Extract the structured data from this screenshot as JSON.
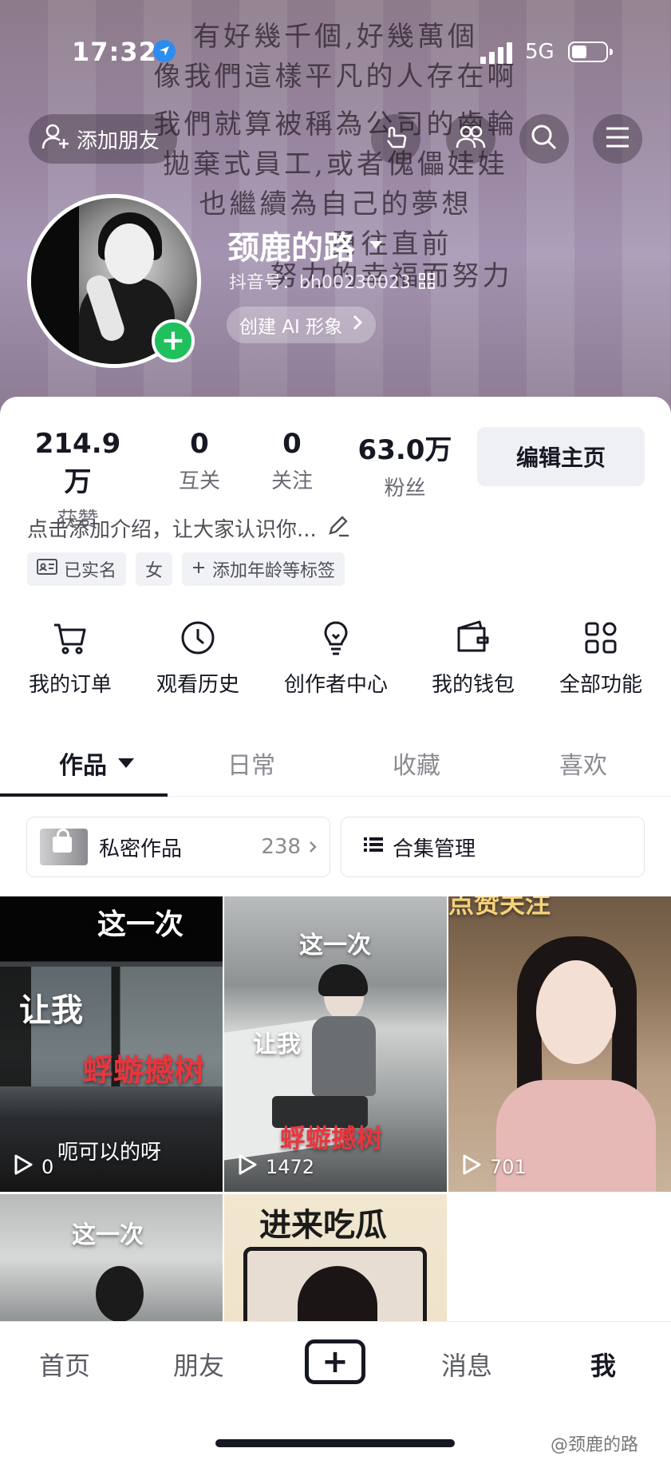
{
  "status_bar": {
    "time": "17:32",
    "network": "5G"
  },
  "cover_lyrics": [
    "有好幾千個,好幾萬個",
    "像我們這樣平凡的人存在啊",
    "我們就算被稱為公司的齒輪",
    "拋棄式員工,或者傀儡娃娃",
    "也繼續為自己的夢想",
    "勇往直前",
    "努力的幸福而努力"
  ],
  "header": {
    "add_friend_label": "添加朋友",
    "icons": [
      "visitor-icon",
      "friends-icon",
      "search-icon",
      "menu-icon"
    ]
  },
  "profile": {
    "nickname": "颈鹿的路",
    "douyin_id": "抖音号：bh00230023",
    "ai_button_label": "创建 AI 形象"
  },
  "stats": [
    {
      "value": "214.9万",
      "label": "获赞"
    },
    {
      "value": "0",
      "label": "互关"
    },
    {
      "value": "0",
      "label": "关注"
    },
    {
      "value": "63.0万",
      "label": "粉丝"
    }
  ],
  "edit_button_label": "编辑主页",
  "bio_placeholder": "点击添加介绍，让大家认识你...",
  "tags": {
    "verified": "已实名",
    "gender": "女",
    "add_tag": "添加年龄等标签"
  },
  "quick_actions": [
    {
      "label": "我的订单",
      "icon": "cart-icon"
    },
    {
      "label": "观看历史",
      "icon": "clock-icon"
    },
    {
      "label": "创作者中心",
      "icon": "bulb-icon"
    },
    {
      "label": "我的钱包",
      "icon": "wallet-icon"
    },
    {
      "label": "全部功能",
      "icon": "grid-icon"
    }
  ],
  "tabs": {
    "works": "作品",
    "daily": "日常",
    "favorites": "收藏",
    "likes": "喜欢"
  },
  "managers": {
    "private_label": "私密作品",
    "private_count": "238",
    "collection_label": "合集管理"
  },
  "videos": [
    {
      "top_text": "这一次",
      "mid_text": "让我",
      "red_text": "蜉蝣撼树",
      "sub_text": "呃可以的呀",
      "plays": "0"
    },
    {
      "top_text": "这一次",
      "mid_text": "让我",
      "red_text": "蜉蝣撼树",
      "plays": "1472"
    },
    {
      "top_text": "点赞关注",
      "plays": "701"
    },
    {
      "top_text": "这一次"
    },
    {
      "top_text": "进来吃瓜"
    }
  ],
  "bottom_nav": {
    "home": "首页",
    "friends": "朋友",
    "messages": "消息",
    "me": "我"
  },
  "watermark": "@颈鹿的路"
}
